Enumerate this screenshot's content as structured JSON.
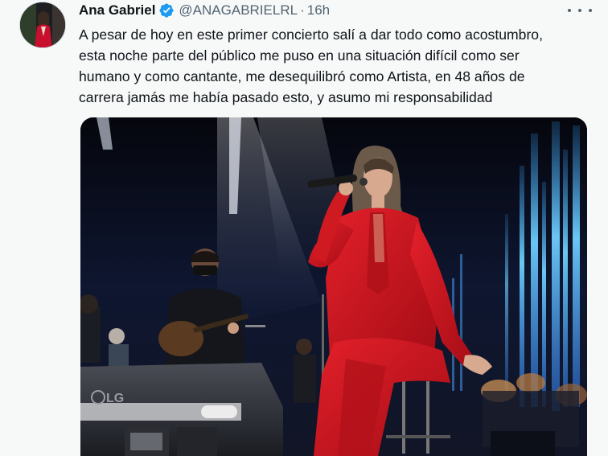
{
  "author": {
    "name": "Ana Gabriel",
    "handle": "@ANAGABRIELRL",
    "separator": "·",
    "time": "16h",
    "verified_icon": "verified-badge-icon",
    "verified_color": "#1d9bf0"
  },
  "tweet": {
    "lines": [
      "A pesar de hoy en este primer concierto salí a dar todo como acostumbro,",
      "esta noche parte del público me puso en una situación difícil como ser",
      "humano y como cantante, me desequilibró como Artista, en 48 años de",
      "carrera jamás me había pasado esto, y asumo mi responsabilidad"
    ]
  },
  "media": {
    "monitor_brand": "LG"
  },
  "icons": {
    "more": "more-options-icon"
  },
  "colors": {
    "background": "#f7f9f9",
    "text": "#0f1419",
    "secondary": "#536471",
    "accent": "#1d9bf0",
    "suit": "#d4161d"
  }
}
